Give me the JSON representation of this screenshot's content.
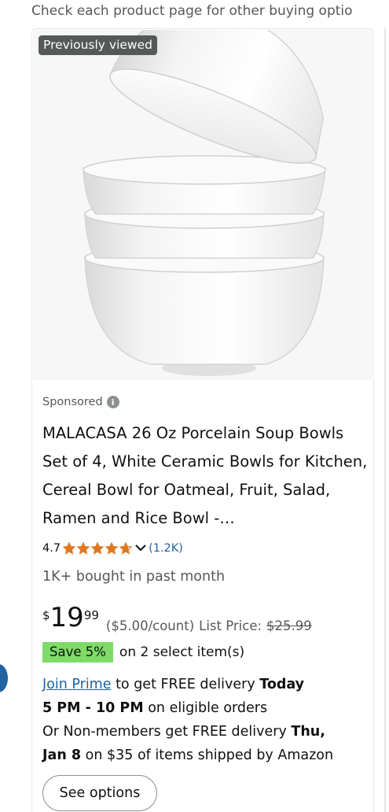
{
  "notice": "Check each product page for other buying optio",
  "product": {
    "badge": "Previously viewed",
    "sponsored_label": "Sponsored",
    "title": "MALACASA 26 Oz Porcelain Soup Bowls Set of 4, White Ceramic Bowls for Kitchen, Cereal Bowl for Oatmeal, Fruit, Salad, Ramen and Rice Bowl -…",
    "rating": "4.7",
    "rating_fraction": 0.94,
    "rating_count": "(1.2K)",
    "bought": "1K+ bought in past month",
    "price": {
      "currency": "$",
      "whole": "19",
      "fraction": "99",
      "unit_price": "($5.00/count)",
      "list_label": "List Price:",
      "list_price": "$25.99"
    },
    "save": {
      "badge": "Save 5%",
      "text": "on 2 select item(s)"
    },
    "delivery": {
      "prime_link": "Join Prime",
      "prime_text_1": " to get FREE delivery ",
      "prime_bold_1": "Today",
      "prime_bold_2": "5 PM - 10 PM",
      "prime_text_2": " on eligible orders",
      "nonmember_text_1": "Or Non-members get FREE delivery ",
      "nonmember_bold_1": "Thu,",
      "nonmember_bold_2": "Jan 8",
      "nonmember_text_2": " on $35 of items shipped by Amazon"
    },
    "button": "See options"
  },
  "colors": {
    "star": "#de7921",
    "link": "#2162a1",
    "save_badge": "#7fda69",
    "badge_bg": "#565959"
  }
}
